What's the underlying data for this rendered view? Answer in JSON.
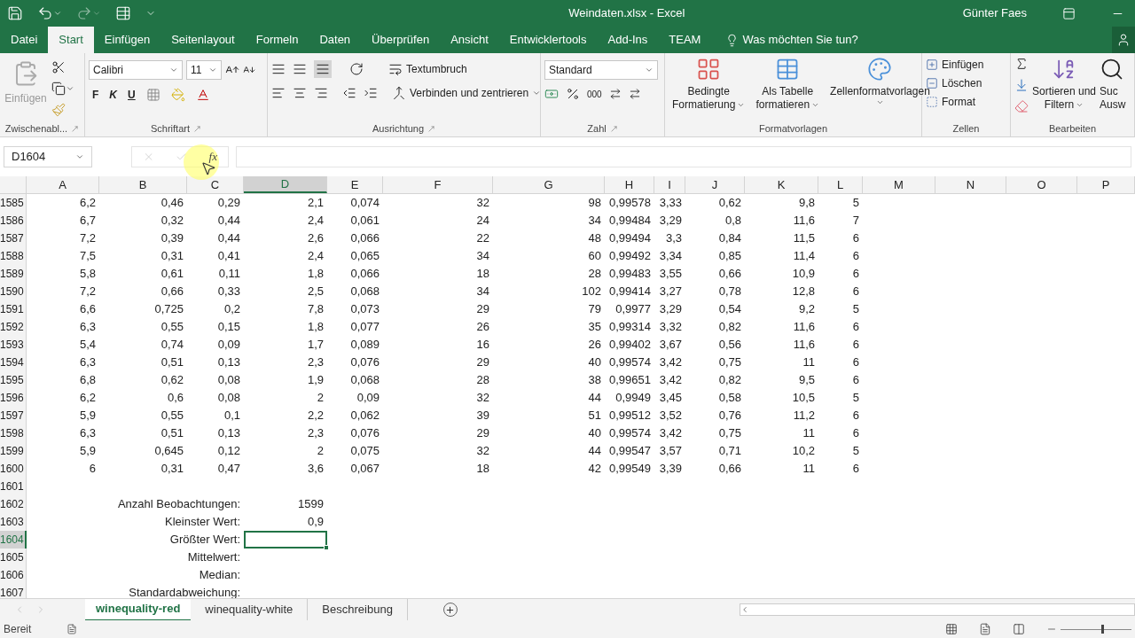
{
  "window": {
    "title": "Weindaten.xlsx - Excel",
    "user": "Günter Faes"
  },
  "ribbon_tabs": [
    {
      "label": "Datei",
      "selected": false
    },
    {
      "label": "Start",
      "selected": true
    },
    {
      "label": "Einfügen",
      "selected": false
    },
    {
      "label": "Seitenlayout",
      "selected": false
    },
    {
      "label": "Formeln",
      "selected": false
    },
    {
      "label": "Daten",
      "selected": false
    },
    {
      "label": "Überprüfen",
      "selected": false
    },
    {
      "label": "Ansicht",
      "selected": false
    },
    {
      "label": "Entwicklertools",
      "selected": false
    },
    {
      "label": "Add-Ins",
      "selected": false
    },
    {
      "label": "TEAM",
      "selected": false
    }
  ],
  "tell_me": "Was möchten Sie tun?",
  "clipboard": {
    "paste": "Einfügen",
    "paste_disabled": true,
    "group": "Zwischenabl..."
  },
  "font": {
    "name": "Calibri",
    "size": "11",
    "styles": [
      "F",
      "K",
      "U"
    ],
    "group": "Schriftart"
  },
  "alignment": {
    "wrap": "Textumbruch",
    "merge": "Verbinden und zentrieren",
    "group": "Ausrichtung"
  },
  "number": {
    "format": "Standard",
    "thousands": "000",
    "group": "Zahl"
  },
  "styles": {
    "items": [
      [
        "Bedingte",
        "Formatierung"
      ],
      [
        "Als Tabelle",
        "formatieren"
      ],
      [
        "Zellenformatvorlagen"
      ]
    ],
    "group": "Formatvorlagen"
  },
  "cells_group": {
    "items": [
      "Einfügen",
      "Löschen",
      "Format"
    ],
    "group": "Zellen"
  },
  "editing": {
    "sort": [
      "Sortieren und",
      "Filtern"
    ],
    "find": [
      "Suc",
      "Ausw"
    ],
    "group": "Bearbeiten"
  },
  "name_box": "D1604",
  "fx": "fx",
  "columns": [
    {
      "label": "A",
      "selected": false
    },
    {
      "label": "B",
      "selected": false
    },
    {
      "label": "C",
      "selected": false
    },
    {
      "label": "D",
      "selected": true
    },
    {
      "label": "E",
      "selected": false
    },
    {
      "label": "F",
      "selected": false
    },
    {
      "label": "G",
      "selected": false
    },
    {
      "label": "H",
      "selected": false
    },
    {
      "label": "I",
      "selected": false
    },
    {
      "label": "J",
      "selected": false
    },
    {
      "label": "K",
      "selected": false
    },
    {
      "label": "L",
      "selected": false
    },
    {
      "label": "M",
      "selected": false
    },
    {
      "label": "N",
      "selected": false
    },
    {
      "label": "O",
      "selected": false
    },
    {
      "label": "P",
      "selected": false
    }
  ],
  "rows": [
    {
      "number": "1585",
      "selected": false,
      "cells": [
        "6,2",
        "0,46",
        "0,29",
        "2,1",
        "0,074",
        "32",
        "98",
        "0,99578",
        "3,33",
        "0,62",
        "9,8",
        "5"
      ]
    },
    {
      "number": "1586",
      "selected": false,
      "cells": [
        "6,7",
        "0,32",
        "0,44",
        "2,4",
        "0,061",
        "24",
        "34",
        "0,99484",
        "3,29",
        "0,8",
        "11,6",
        "7"
      ]
    },
    {
      "number": "1587",
      "selected": false,
      "cells": [
        "7,2",
        "0,39",
        "0,44",
        "2,6",
        "0,066",
        "22",
        "48",
        "0,99494",
        "3,3",
        "0,84",
        "11,5",
        "6"
      ]
    },
    {
      "number": "1588",
      "selected": false,
      "cells": [
        "7,5",
        "0,31",
        "0,41",
        "2,4",
        "0,065",
        "34",
        "60",
        "0,99492",
        "3,34",
        "0,85",
        "11,4",
        "6"
      ]
    },
    {
      "number": "1589",
      "selected": false,
      "cells": [
        "5,8",
        "0,61",
        "0,11",
        "1,8",
        "0,066",
        "18",
        "28",
        "0,99483",
        "3,55",
        "0,66",
        "10,9",
        "6"
      ]
    },
    {
      "number": "1590",
      "selected": false,
      "cells": [
        "7,2",
        "0,66",
        "0,33",
        "2,5",
        "0,068",
        "34",
        "102",
        "0,99414",
        "3,27",
        "0,78",
        "12,8",
        "6"
      ]
    },
    {
      "number": "1591",
      "selected": false,
      "cells": [
        "6,6",
        "0,725",
        "0,2",
        "7,8",
        "0,073",
        "29",
        "79",
        "0,9977",
        "3,29",
        "0,54",
        "9,2",
        "5"
      ]
    },
    {
      "number": "1592",
      "selected": false,
      "cells": [
        "6,3",
        "0,55",
        "0,15",
        "1,8",
        "0,077",
        "26",
        "35",
        "0,99314",
        "3,32",
        "0,82",
        "11,6",
        "6"
      ]
    },
    {
      "number": "1593",
      "selected": false,
      "cells": [
        "5,4",
        "0,74",
        "0,09",
        "1,7",
        "0,089",
        "16",
        "26",
        "0,99402",
        "3,67",
        "0,56",
        "11,6",
        "6"
      ]
    },
    {
      "number": "1594",
      "selected": false,
      "cells": [
        "6,3",
        "0,51",
        "0,13",
        "2,3",
        "0,076",
        "29",
        "40",
        "0,99574",
        "3,42",
        "0,75",
        "11",
        "6"
      ]
    },
    {
      "number": "1595",
      "selected": false,
      "cells": [
        "6,8",
        "0,62",
        "0,08",
        "1,9",
        "0,068",
        "28",
        "38",
        "0,99651",
        "3,42",
        "0,82",
        "9,5",
        "6"
      ]
    },
    {
      "number": "1596",
      "selected": false,
      "cells": [
        "6,2",
        "0,6",
        "0,08",
        "2",
        "0,09",
        "32",
        "44",
        "0,9949",
        "3,45",
        "0,58",
        "10,5",
        "5"
      ]
    },
    {
      "number": "1597",
      "selected": false,
      "cells": [
        "5,9",
        "0,55",
        "0,1",
        "2,2",
        "0,062",
        "39",
        "51",
        "0,99512",
        "3,52",
        "0,76",
        "11,2",
        "6"
      ]
    },
    {
      "number": "1598",
      "selected": false,
      "cells": [
        "6,3",
        "0,51",
        "0,13",
        "2,3",
        "0,076",
        "29",
        "40",
        "0,99574",
        "3,42",
        "0,75",
        "11",
        "6"
      ]
    },
    {
      "number": "1599",
      "selected": false,
      "cells": [
        "5,9",
        "0,645",
        "0,12",
        "2",
        "0,075",
        "32",
        "44",
        "0,99547",
        "3,57",
        "0,71",
        "10,2",
        "5"
      ]
    },
    {
      "number": "1600",
      "selected": false,
      "cells": [
        "6",
        "0,31",
        "0,47",
        "3,6",
        "0,067",
        "18",
        "42",
        "0,99549",
        "3,39",
        "0,66",
        "11",
        "6"
      ]
    },
    {
      "number": "1601",
      "selected": false,
      "cells": []
    },
    {
      "number": "1602",
      "selected": false,
      "cells": [
        null,
        null,
        "Anzahl Beobachtungen:",
        "1599"
      ]
    },
    {
      "number": "1603",
      "selected": false,
      "cells": [
        null,
        null,
        "Kleinster Wert:",
        "0,9"
      ]
    },
    {
      "number": "1604",
      "selected": true,
      "cells": [
        null,
        null,
        "Größter Wert:"
      ]
    },
    {
      "number": "1605",
      "selected": false,
      "cells": [
        null,
        null,
        "Mittelwert:"
      ]
    },
    {
      "number": "1606",
      "selected": false,
      "cells": [
        null,
        null,
        "Median:"
      ]
    },
    {
      "number": "1607",
      "selected": false,
      "cells": [
        null,
        null,
        "Standardabweichung:"
      ]
    }
  ],
  "sheet_tabs": [
    {
      "label": "winequality-red",
      "selected": true
    },
    {
      "label": "winequality-white",
      "selected": false
    },
    {
      "label": "Beschreibung",
      "selected": false
    }
  ],
  "status": "Bereit",
  "zoom": {
    "level": 0.6
  }
}
